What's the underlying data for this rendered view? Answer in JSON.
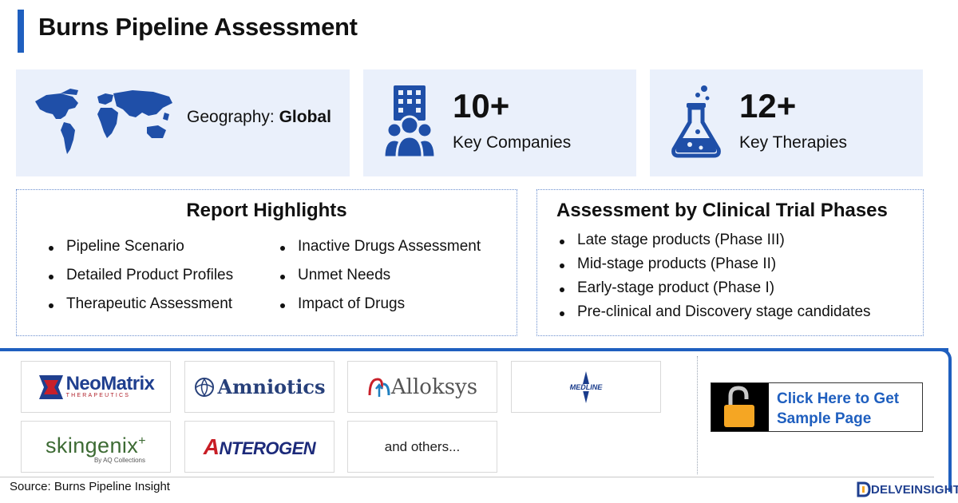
{
  "title": "Burns Pipeline Assessment",
  "geography": {
    "label": "Geography: ",
    "value": "Global"
  },
  "stats": [
    {
      "number": "10+",
      "label": "Key Companies",
      "icon": "company-icon"
    },
    {
      "number": "12+",
      "label": "Key Therapies",
      "icon": "flask-icon"
    }
  ],
  "report_highlights": {
    "title": "Report Highlights",
    "col1": [
      "Pipeline Scenario",
      "Detailed Product Profiles",
      "Therapeutic Assessment"
    ],
    "col2": [
      "Inactive Drugs Assessment",
      "Unmet Needs",
      "Impact of Drugs"
    ]
  },
  "phases": {
    "title": "Assessment by Clinical Trial Phases",
    "items": [
      "Late stage products (Phase III)",
      "Mid-stage products (Phase II)",
      "Early-stage product (Phase I)",
      "Pre-clinical and Discovery stage candidates"
    ]
  },
  "logos": {
    "neomatrix": {
      "name": "NeoMatrix",
      "sub": "THERAPEUTICS"
    },
    "amniotics": "Amniotics",
    "alloksys": "Alloksys",
    "medline": "MEDLINE",
    "skingenix": {
      "name": "skingenix",
      "sup": "+",
      "sub": "By AQ Collections"
    },
    "anterogen": {
      "first": "A",
      "rest": "NTEROGEN"
    },
    "others": "and others..."
  },
  "cta": {
    "line1": "Click Here to Get",
    "line2": "Sample Page"
  },
  "source": "Source: Burns Pipeline Insight",
  "brand": "DELVEINSIGHT",
  "colors": {
    "accent": "#1f5fbf",
    "card_bg": "#eaf0fb",
    "lock": "#f5a623"
  }
}
